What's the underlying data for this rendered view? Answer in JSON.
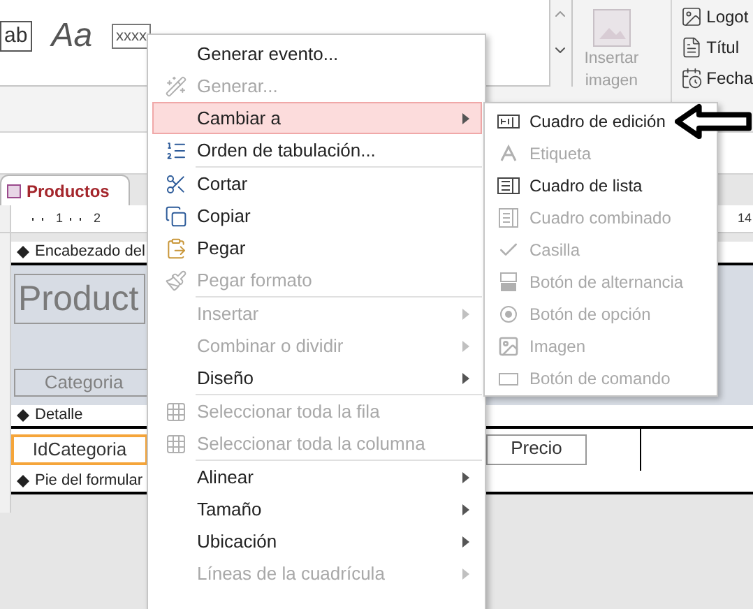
{
  "ribbon": {
    "gallery": [
      {
        "kind": "textbox",
        "label": "ab"
      },
      {
        "kind": "label",
        "label": "Aa"
      },
      {
        "kind": "field",
        "label": "xxxx"
      }
    ],
    "insert_image": {
      "label": "Insertar imagen",
      "disabled": true
    },
    "header_items": [
      {
        "label": "Logot"
      },
      {
        "label": "Títul"
      },
      {
        "label": "Fecha"
      }
    ]
  },
  "document_tab": {
    "label": "Productos",
    "selected": true
  },
  "ruler": {
    "left_marks": [
      "1",
      "2"
    ],
    "right_mark": "14"
  },
  "form": {
    "sections": [
      {
        "label": "Encabezado del",
        "kind": "header",
        "controls": [
          {
            "kind": "title",
            "label": "Product",
            "selected": false
          },
          {
            "kind": "label",
            "label": "Categoria",
            "selected": false
          }
        ]
      },
      {
        "label": "Detalle",
        "kind": "detail",
        "controls": [
          {
            "kind": "textbox",
            "label": "IdCategoria",
            "selected": true
          },
          {
            "kind": "textbox",
            "label": "Precio",
            "selected": false
          }
        ]
      },
      {
        "label": "Pie del formular",
        "kind": "footer"
      }
    ]
  },
  "context_menu": {
    "groups": [
      [
        {
          "label": "Generar evento...",
          "kind": "plain",
          "disabled": false,
          "submenu": false,
          "selected": false
        },
        {
          "label": "Generar...",
          "kind": "wand",
          "disabled": true,
          "submenu": false,
          "selected": false
        },
        {
          "label": "Cambiar a",
          "kind": "plain",
          "disabled": false,
          "submenu": true,
          "selected": true
        },
        {
          "label": "Orden de tabulación...",
          "kind": "order",
          "disabled": false,
          "submenu": false,
          "selected": false
        }
      ],
      [
        {
          "label": "Cortar",
          "kind": "cut",
          "disabled": false,
          "submenu": false,
          "selected": false
        },
        {
          "label": "Copiar",
          "kind": "copy",
          "disabled": false,
          "submenu": false,
          "selected": false
        },
        {
          "label": "Pegar",
          "kind": "paste",
          "disabled": false,
          "submenu": false,
          "selected": false
        },
        {
          "label": "Pegar formato",
          "kind": "painter",
          "disabled": true,
          "submenu": false,
          "selected": false
        }
      ],
      [
        {
          "label": "Insertar",
          "kind": "plain",
          "disabled": true,
          "submenu": true,
          "selected": false
        },
        {
          "label": "Combinar o dividir",
          "kind": "plain",
          "disabled": true,
          "submenu": true,
          "selected": false
        },
        {
          "label": "Diseño",
          "kind": "plain",
          "disabled": false,
          "submenu": true,
          "selected": false
        }
      ],
      [
        {
          "label": "Seleccionar toda la fila",
          "kind": "grid",
          "disabled": true,
          "submenu": false,
          "selected": false
        },
        {
          "label": "Seleccionar toda la columna",
          "kind": "grid",
          "disabled": true,
          "submenu": false,
          "selected": false
        }
      ],
      [
        {
          "label": "Alinear",
          "kind": "plain",
          "disabled": false,
          "submenu": true,
          "selected": false
        },
        {
          "label": "Tamaño",
          "kind": "plain",
          "disabled": false,
          "submenu": true,
          "selected": false
        },
        {
          "label": "Ubicación",
          "kind": "plain",
          "disabled": false,
          "submenu": true,
          "selected": false
        },
        {
          "label": "Líneas de la cuadrícula",
          "kind": "plain",
          "disabled": true,
          "submenu": true,
          "selected": false
        }
      ]
    ]
  },
  "submenu": [
    {
      "label": "Cuadro de edición",
      "kind": "textbox",
      "disabled": false
    },
    {
      "label": "Etiqueta",
      "kind": "label",
      "disabled": true
    },
    {
      "label": "Cuadro de lista",
      "kind": "listbox",
      "disabled": false
    },
    {
      "label": "Cuadro combinado",
      "kind": "combobox",
      "disabled": true
    },
    {
      "label": "Casilla",
      "kind": "checkbox",
      "disabled": true
    },
    {
      "label": "Botón de alternancia",
      "kind": "toggle",
      "disabled": true
    },
    {
      "label": "Botón de opción",
      "kind": "radio",
      "disabled": true
    },
    {
      "label": "Imagen",
      "kind": "image",
      "disabled": true
    },
    {
      "label": "Botón de comando",
      "kind": "button",
      "disabled": true
    }
  ],
  "annotation": {
    "kind": "arrow"
  }
}
